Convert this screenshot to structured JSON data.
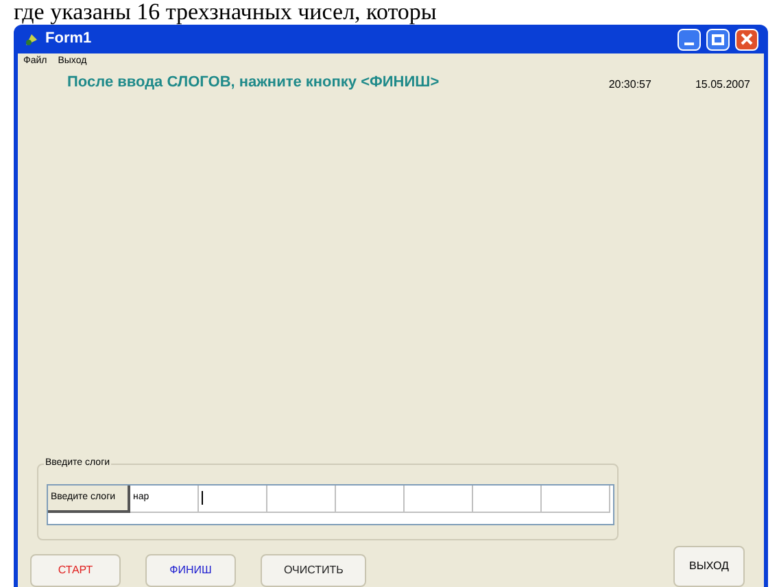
{
  "document_text": "где указаны 16 трехзначных чисел, которы",
  "window": {
    "title": "Form1"
  },
  "menu": [
    "Файл",
    "Выход"
  ],
  "instruction": "После ввода СЛОГОВ, нажните кнопку <ФИНИШ>",
  "time": "20:30:57",
  "date": "15.05.2007",
  "group": {
    "title": "Введите слоги",
    "row_header": "Введите слоги",
    "cells": [
      {
        "kind": "text",
        "text": "нар"
      },
      {
        "kind": "caret"
      },
      {
        "kind": "empty"
      },
      {
        "kind": "empty"
      },
      {
        "kind": "empty"
      },
      {
        "kind": "empty"
      },
      {
        "kind": "empty"
      }
    ]
  },
  "buttons": [
    {
      "label": "СТАРТ",
      "color": "#e02020"
    },
    {
      "label": "ФИНИШ",
      "color": "#2020d0"
    },
    {
      "label": "ОЧИСТИТЬ",
      "color": "#202020"
    }
  ],
  "exit_button": {
    "label": "ВЫХОД"
  }
}
